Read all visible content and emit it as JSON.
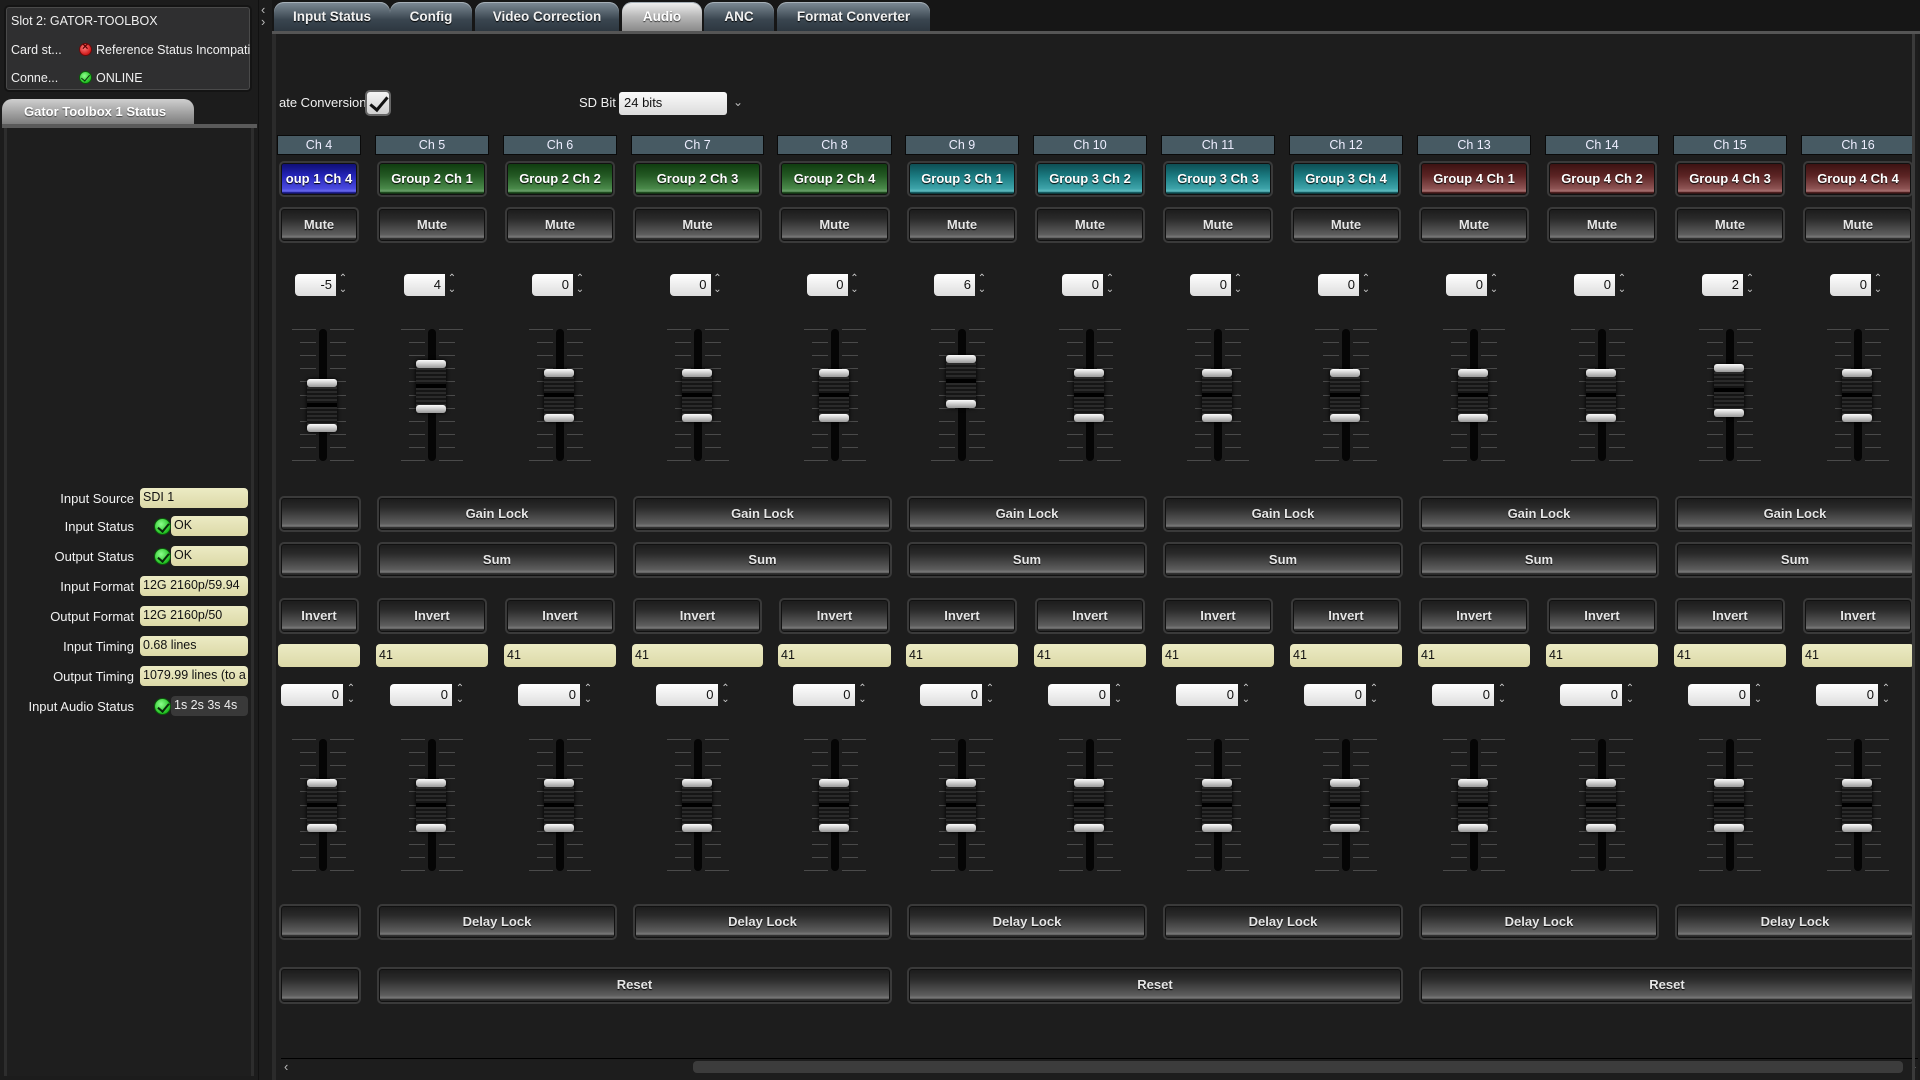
{
  "card": {
    "title": "Slot 2: GATOR-TOOLBOX",
    "card_status_label": "Card st...",
    "card_status_value": "Reference Status Incompati",
    "card_status_state": "error",
    "connection_label": "Conne...",
    "connection_value": "ONLINE",
    "connection_state": "ok"
  },
  "status_panel": {
    "tab_label": "Gator Toolbox 1 Status",
    "rows": [
      {
        "label": "Input Source",
        "value": "SDI 1",
        "indicator": null
      },
      {
        "label": "Input Status",
        "value": "OK",
        "indicator": "ok"
      },
      {
        "label": "Output Status",
        "value": "OK",
        "indicator": "ok"
      },
      {
        "label": "Input Format",
        "value": "12G 2160p/59.94",
        "indicator": null
      },
      {
        "label": "Output Format",
        "value": "12G 2160p/50",
        "indicator": null
      },
      {
        "label": "Input Timing",
        "value": "0.68 lines",
        "indicator": null
      },
      {
        "label": "Output Timing",
        "value": "1079.99 lines (to a",
        "indicator": null
      },
      {
        "label": "Input Audio Status",
        "value": "1s 2s 3s 4s",
        "indicator": "ok"
      }
    ]
  },
  "splitter": {
    "collapse_icon": "‹",
    "expand_icon": "›"
  },
  "tabs": [
    {
      "label": "Input Status",
      "active": false
    },
    {
      "label": "Config",
      "active": false
    },
    {
      "label": "Video Correction",
      "active": false
    },
    {
      "label": "Audio",
      "active": true
    },
    {
      "label": "ANC",
      "active": false
    },
    {
      "label": "Format Converter",
      "active": false
    }
  ],
  "audio": {
    "rate_conversion_label": "ate Conversion",
    "rate_conversion_checked": true,
    "sd_bit_label": "SD Bit",
    "sd_bit_value": "24 bits",
    "group_colors": {
      "1": "#2a2ac8",
      "2": "#2e6b2e",
      "3": "#2a8c92",
      "4": "#6e3434"
    },
    "channels": [
      {
        "header": "Ch 4",
        "group_label": "oup 1 Ch 4",
        "group": 1,
        "mute": "Mute",
        "gain": "-5",
        "gain_db": -5,
        "invert": "Invert",
        "delay_readout": "",
        "delay": "0",
        "delay_level": 0
      },
      {
        "header": "Ch 5",
        "group_label": "Group 2 Ch 1",
        "group": 2,
        "mute": "Mute",
        "gain": "4",
        "gain_db": 4,
        "invert": "Invert",
        "delay_readout": "41",
        "delay": "0",
        "delay_level": 0
      },
      {
        "header": "Ch 6",
        "group_label": "Group 2 Ch 2",
        "group": 2,
        "mute": "Mute",
        "gain": "0",
        "gain_db": 0,
        "invert": "Invert",
        "delay_readout": "41",
        "delay": "0",
        "delay_level": 0
      },
      {
        "header": "Ch 7",
        "group_label": "Group 2 Ch 3",
        "group": 2,
        "mute": "Mute",
        "gain": "0",
        "gain_db": 0,
        "invert": "Invert",
        "delay_readout": "41",
        "delay": "0",
        "delay_level": 0
      },
      {
        "header": "Ch 8",
        "group_label": "Group 2 Ch 4",
        "group": 2,
        "mute": "Mute",
        "gain": "0",
        "gain_db": 0,
        "invert": "Invert",
        "delay_readout": "41",
        "delay": "0",
        "delay_level": 0
      },
      {
        "header": "Ch 9",
        "group_label": "Group 3 Ch 1",
        "group": 3,
        "mute": "Mute",
        "gain": "6",
        "gain_db": 6,
        "invert": "Invert",
        "delay_readout": "41",
        "delay": "0",
        "delay_level": 0
      },
      {
        "header": "Ch 10",
        "group_label": "Group 3 Ch 2",
        "group": 3,
        "mute": "Mute",
        "gain": "0",
        "gain_db": 0,
        "invert": "Invert",
        "delay_readout": "41",
        "delay": "0",
        "delay_level": 0
      },
      {
        "header": "Ch 11",
        "group_label": "Group 3 Ch 3",
        "group": 3,
        "mute": "Mute",
        "gain": "0",
        "gain_db": 0,
        "invert": "Invert",
        "delay_readout": "41",
        "delay": "0",
        "delay_level": 0
      },
      {
        "header": "Ch 12",
        "group_label": "Group 3 Ch 4",
        "group": 3,
        "mute": "Mute",
        "gain": "0",
        "gain_db": 0,
        "invert": "Invert",
        "delay_readout": "41",
        "delay": "0",
        "delay_level": 0
      },
      {
        "header": "Ch 13",
        "group_label": "Group 4 Ch 1",
        "group": 4,
        "mute": "Mute",
        "gain": "0",
        "gain_db": 0,
        "invert": "Invert",
        "delay_readout": "41",
        "delay": "0",
        "delay_level": 0
      },
      {
        "header": "Ch 14",
        "group_label": "Group 4 Ch 2",
        "group": 4,
        "mute": "Mute",
        "gain": "0",
        "gain_db": 0,
        "invert": "Invert",
        "delay_readout": "41",
        "delay": "0",
        "delay_level": 0
      },
      {
        "header": "Ch 15",
        "group_label": "Group 4 Ch 3",
        "group": 4,
        "mute": "Mute",
        "gain": "2",
        "gain_db": 2,
        "invert": "Invert",
        "delay_readout": "41",
        "delay": "0",
        "delay_level": 0
      },
      {
        "header": "Ch 16",
        "group_label": "Group 4 Ch 4",
        "group": 4,
        "mute": "Mute",
        "gain": "0",
        "gain_db": 0,
        "invert": "Invert",
        "delay_readout": "41",
        "delay": "0",
        "delay_level": 0
      }
    ],
    "gain_range_db": [
      -18,
      18
    ],
    "pair_buttons": {
      "gain_lock": "Gain Lock",
      "sum": "Sum",
      "delay_lock": "Delay Lock"
    },
    "reset_label": "Reset"
  },
  "scrollbar": {
    "left_icon": "‹",
    "right_icon": "›"
  }
}
